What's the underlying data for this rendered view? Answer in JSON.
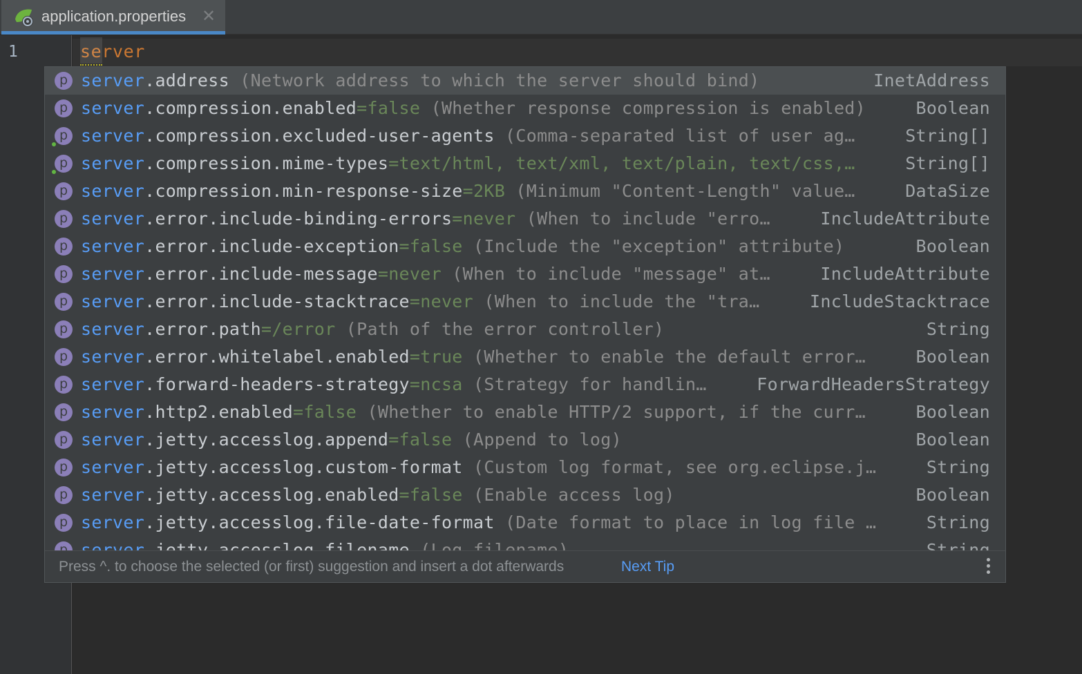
{
  "tab": {
    "icon": "spring-leaf-icon",
    "title": "application.properties",
    "close_icon": "close-icon"
  },
  "editor": {
    "line_number": "1",
    "code": "server"
  },
  "completion": {
    "items": [
      {
        "prefix": "server",
        "name": ".address",
        "default": "",
        "desc": " (Network address to which the server should bind)",
        "type": "InetAddress",
        "selected": true
      },
      {
        "prefix": "server",
        "name": ".compression.enabled",
        "default": "=false",
        "desc": " (Whether response compression is enabled)",
        "type": "Boolean"
      },
      {
        "prefix": "server",
        "name": ".compression.excluded-user-agents",
        "default": "",
        "desc": " (Comma-separated list of user ag…",
        "type": "String[]",
        "dot": true
      },
      {
        "prefix": "server",
        "name": ".compression.mime-types",
        "default": "=text/html, text/xml, text/plain, text/css,…",
        "desc": "",
        "type": "String[]",
        "dot": true
      },
      {
        "prefix": "server",
        "name": ".compression.min-response-size",
        "default": "=2KB",
        "desc": " (Minimum \"Content-Length\" value…",
        "type": "DataSize"
      },
      {
        "prefix": "server",
        "name": ".error.include-binding-errors",
        "default": "=never",
        "desc": " (When to include \"erro…",
        "type": "IncludeAttribute"
      },
      {
        "prefix": "server",
        "name": ".error.include-exception",
        "default": "=false",
        "desc": " (Include the \"exception\" attribute)",
        "type": "Boolean"
      },
      {
        "prefix": "server",
        "name": ".error.include-message",
        "default": "=never",
        "desc": " (When to include \"message\" at…",
        "type": "IncludeAttribute"
      },
      {
        "prefix": "server",
        "name": ".error.include-stacktrace",
        "default": "=never",
        "desc": " (When to include the \"tra…",
        "type": "IncludeStacktrace"
      },
      {
        "prefix": "server",
        "name": ".error.path",
        "default": "=/error",
        "desc": " (Path of the error controller)",
        "type": "String"
      },
      {
        "prefix": "server",
        "name": ".error.whitelabel.enabled",
        "default": "=true",
        "desc": " (Whether to enable the default error…",
        "type": "Boolean"
      },
      {
        "prefix": "server",
        "name": ".forward-headers-strategy",
        "default": "=ncsa",
        "desc": " (Strategy for handlin…",
        "type": "ForwardHeadersStrategy"
      },
      {
        "prefix": "server",
        "name": ".http2.enabled",
        "default": "=false",
        "desc": " (Whether to enable HTTP/2 support, if the curr…",
        "type": "Boolean"
      },
      {
        "prefix": "server",
        "name": ".jetty.accesslog.append",
        "default": "=false",
        "desc": " (Append to log)",
        "type": "Boolean"
      },
      {
        "prefix": "server",
        "name": ".jetty.accesslog.custom-format",
        "default": "",
        "desc": " (Custom log format, see org.eclipse.j…",
        "type": "String"
      },
      {
        "prefix": "server",
        "name": ".jetty.accesslog.enabled",
        "default": "=false",
        "desc": " (Enable access log)",
        "type": "Boolean"
      },
      {
        "prefix": "server",
        "name": ".jetty.accesslog.file-date-format",
        "default": "",
        "desc": " (Date format to place in log file …",
        "type": "String"
      },
      {
        "prefix": "server",
        "name": ".jetty.accesslog.filename",
        "default": "",
        "desc": " (Log filename)",
        "type": "String"
      }
    ],
    "item_icon_letter": "p",
    "footer": {
      "tip": "Press ^. to choose the selected (or first) suggestion and insert a dot afterwards",
      "next_tip": "Next Tip",
      "more_icon": "more-vertical-icon"
    }
  }
}
